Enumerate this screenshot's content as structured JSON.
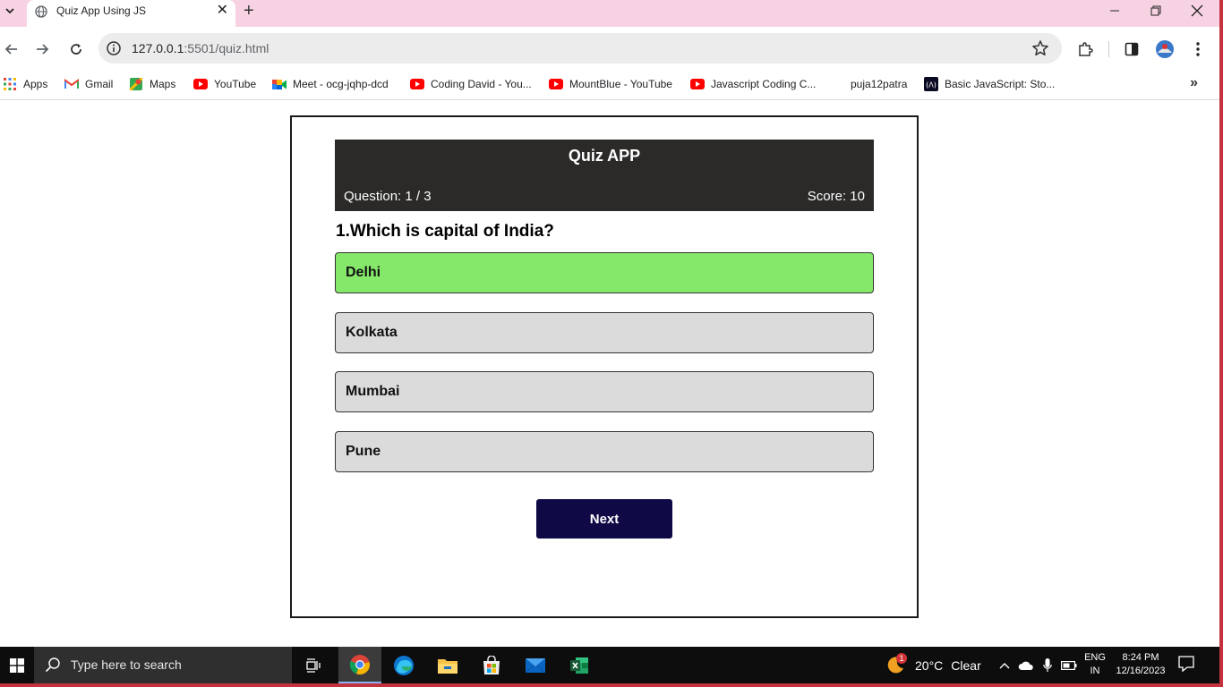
{
  "tab": {
    "title": "Quiz App Using JS"
  },
  "address": {
    "host": "127.0.0.1",
    "path": ":5501/quiz.html"
  },
  "bookmarks": [
    {
      "label": "Apps",
      "icon": "apps-grid-icon"
    },
    {
      "label": "Gmail",
      "icon": "gmail-icon"
    },
    {
      "label": "Maps",
      "icon": "maps-icon"
    },
    {
      "label": "YouTube",
      "icon": "youtube-icon"
    },
    {
      "label": "Meet - ocg-jqhp-dcd",
      "icon": "meet-icon"
    },
    {
      "label": "Coding David - You...",
      "icon": "youtube-icon"
    },
    {
      "label": "MountBlue - YouTube",
      "icon": "youtube-icon"
    },
    {
      "label": "Javascript Coding C...",
      "icon": "youtube-icon"
    },
    {
      "label": "puja12patra",
      "icon": ""
    },
    {
      "label": "Basic JavaScript: Sto...",
      "icon": "freecodecamp-icon"
    }
  ],
  "quiz": {
    "title": "Quiz APP",
    "question_counter": "Question: 1 / 3",
    "score": "Score: 10",
    "question": "1.Which is capital of India?",
    "options": [
      {
        "label": "Delhi",
        "state": "correct"
      },
      {
        "label": "Kolkata",
        "state": "default"
      },
      {
        "label": "Mumbai",
        "state": "default"
      },
      {
        "label": "Pune",
        "state": "default"
      }
    ],
    "next_label": "Next"
  },
  "taskbar": {
    "search_placeholder": "Type here to search",
    "weather": {
      "temp": "20°C",
      "condition": "Clear",
      "badge": "1"
    },
    "lang": {
      "line1": "ENG",
      "line2": "IN"
    },
    "clock": {
      "time": "8:24 PM",
      "date": "12/16/2023"
    }
  },
  "colors": {
    "tab_strip": "#f7d2e3",
    "header_bg": "#2b2a29",
    "option_bg": "#dbdbdb",
    "correct_bg": "#86e86a",
    "next_bg": "#0f0945"
  }
}
